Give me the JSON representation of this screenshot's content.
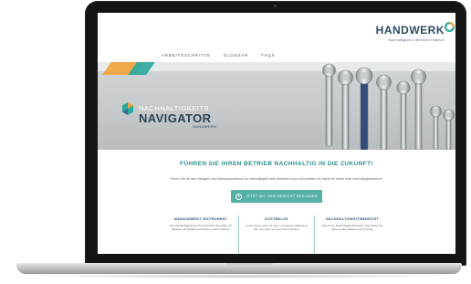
{
  "site": {
    "brand": {
      "name": "HANDWERK",
      "tagline": "Nachhaltigkeit in Betrieben stärken"
    },
    "nav": [
      "ARBEITSSCHRITTE",
      "GLOSSAR",
      "FAQS"
    ],
    "hero": {
      "logo_line1": "NACHHALTIGKEITS",
      "logo_line2": "NAVIGATOR",
      "logo_line3": "HANDWERK"
    },
    "headline": "FÜHREN SIE IHREN BETRIEB NACHHALTIG IN DIE ZUKUNFT!",
    "intro": "Führen Sie mit dem Navigator eine Bestandsaufnahme zur Nachhaltigkeit Ihres Betriebes durch und erstellen Sie Schritt für Schritt Ihren Nachhaltigkeitsbericht.",
    "cta": {
      "icon": "plus-icon",
      "label": "JETZT MIT DEM BERICHT BEGINNEN"
    },
    "columns": [
      {
        "title": "MANAGEMENT INSTRUMENT",
        "text": "Der Nachhaltigkeitsbericht unterstützt Sie dabei, Ihr Handeln nachhaltig auszurichten und zu planen."
      },
      {
        "title": "KOSTENLOS",
        "text": "Lorem ipsum dolor sit amet, consetetur sadipscing elitr, sed diam nonumy eirmod tempor."
      },
      {
        "title": "NACHHALTIGKEITSBERICHT",
        "text": "Was ist ein Nachhaltigkeitsbericht? Hier finden Sie weitere Informationen zum Thema."
      }
    ]
  },
  "colors": {
    "accent": "#55b0a8",
    "brand_dark": "#2f4a66",
    "orange": "#f0a23a"
  }
}
